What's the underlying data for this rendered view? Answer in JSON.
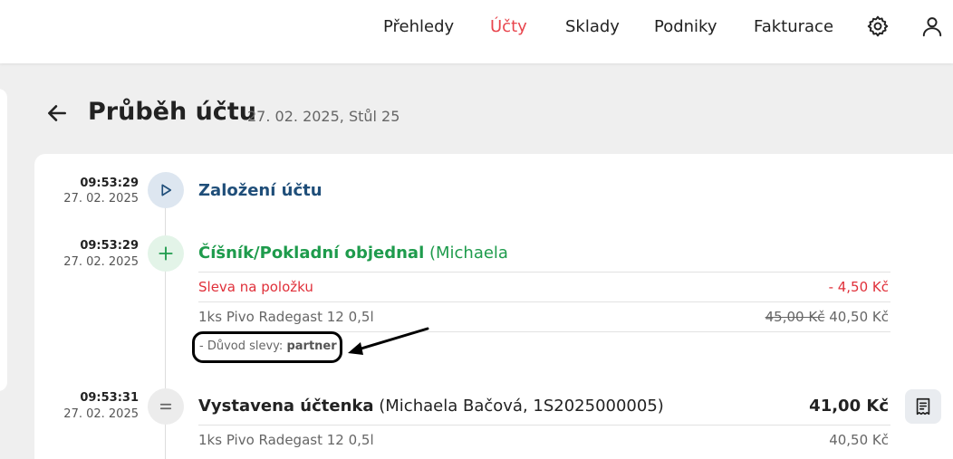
{
  "nav": {
    "items": [
      {
        "label": "Přehledy",
        "active": false
      },
      {
        "label": "Účty",
        "active": true
      },
      {
        "label": "Sklady",
        "active": false
      },
      {
        "label": "Podniky",
        "active": false
      },
      {
        "label": "Fakturace",
        "active": false
      }
    ],
    "settings_icon": "gear-icon",
    "user_icon": "user-icon",
    "active_color": "#e8454d"
  },
  "header": {
    "title": "Průběh účtu",
    "subtitle": "27. 02. 2025, Stůl 25"
  },
  "timeline": [
    {
      "time": "09:53:29",
      "date": "27. 02. 2025",
      "icon": "play-icon",
      "title": "Založení účtu",
      "color": "#1f4e79"
    },
    {
      "time": "09:53:29",
      "date": "27. 02. 2025",
      "icon": "plus-icon",
      "title_bold": "Číšník/Pokladní objednal",
      "title_rest": " (Michaela",
      "color": "#1e9b4c",
      "rows": [
        {
          "left": "Sleva na položku",
          "right": "- 4,50 Kč",
          "color": "#e0303a"
        },
        {
          "left": "1ks Pivo Radegast 12 0,5l",
          "old_price": "45,00 Kč",
          "right": "40,50 Kč",
          "color": "#666"
        }
      ],
      "reason_label": "- Důvod slevy: ",
      "reason_value": "partner"
    },
    {
      "time": "09:53:31",
      "date": "27. 02. 2025",
      "icon": "equals-icon",
      "title_bold": "Vystavena účtenka",
      "title_rest": " (Michaela Bačová, 1S2025000005)",
      "total": "41,00 Kč",
      "color": "#222",
      "rows": [
        {
          "left": "1ks Pivo Radegast 12 0,5l",
          "right": "40,50 Kč",
          "color": "#666"
        }
      ],
      "action_icon": "receipt-icon"
    }
  ]
}
